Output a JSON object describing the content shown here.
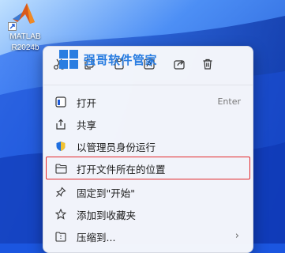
{
  "desktop": {
    "icon_label_line1": "MATLAB",
    "icon_label_line2": "R2024b"
  },
  "context_menu": {
    "quick_actions": [
      {
        "name": "cut-icon"
      },
      {
        "name": "copy-icon"
      },
      {
        "name": "paste-icon"
      },
      {
        "name": "rename-icon"
      },
      {
        "name": "share-icon"
      },
      {
        "name": "delete-icon"
      }
    ],
    "items": [
      {
        "label": "打开",
        "hint": "Enter",
        "icon": "app-icon"
      },
      {
        "label": "共享",
        "icon": "share-icon"
      },
      {
        "label": "以管理员身份运行",
        "icon": "shield-icon"
      },
      {
        "label": "打开文件所在的位置",
        "icon": "folder-icon"
      },
      {
        "label": "固定到\"开始\"",
        "icon": "pin-icon"
      },
      {
        "label": "添加到收藏夹",
        "icon": "star-icon"
      },
      {
        "label": "压缩到...",
        "icon": "zip-icon"
      }
    ],
    "highlight_color": "#e3282b"
  },
  "watermark": {
    "text": "强哥软件管家"
  }
}
